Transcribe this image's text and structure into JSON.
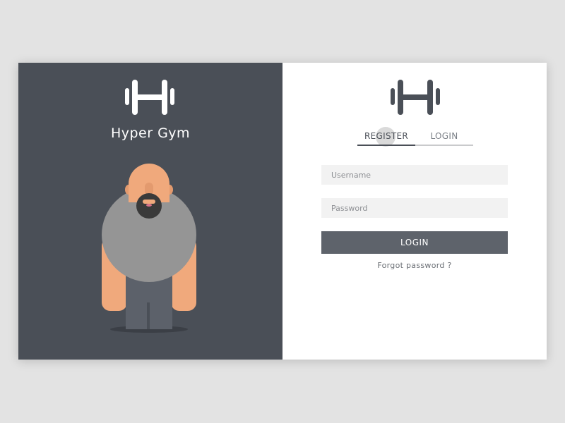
{
  "brand": {
    "name": "Hyper Gym"
  },
  "tabs": {
    "register": "REGISTER",
    "login": "LOGIN",
    "active": "register"
  },
  "form": {
    "username_placeholder": "Username",
    "password_placeholder": "Password",
    "login_button": "LOGIN",
    "forgot_link": "Forgot password ?"
  },
  "colors": {
    "page_bg": "#e3e3e3",
    "left_panel": "#4a4f57",
    "button": "#5e636b",
    "skin": "#f0a97c",
    "shirt": "#959595"
  },
  "icons": {
    "logo": "dumbbell-icon"
  }
}
